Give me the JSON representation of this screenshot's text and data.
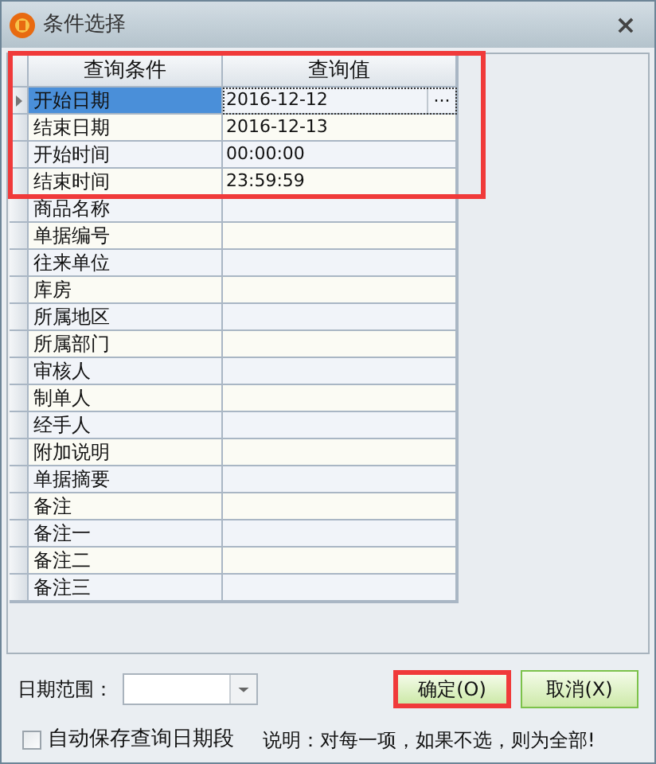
{
  "window": {
    "title": "条件选择",
    "close_label": "×"
  },
  "grid": {
    "columns": [
      "查询条件",
      "查询值"
    ],
    "highlighted_rows": [
      {
        "condition": "开始日期",
        "value": "2016-12-12",
        "selected": true,
        "ellipsis": "···"
      },
      {
        "condition": "结束日期",
        "value": "2016-12-13",
        "selected": false
      },
      {
        "condition": "开始时间",
        "value": "00:00:00",
        "selected": false
      },
      {
        "condition": "结束时间",
        "value": "23:59:59",
        "selected": false
      }
    ],
    "rows": [
      {
        "condition": "商品名称",
        "selected": false
      },
      {
        "condition": "单据编号",
        "selected": false
      },
      {
        "condition": "往来单位",
        "selected": false
      },
      {
        "condition": "库房",
        "selected": false
      },
      {
        "condition": "所属地区",
        "selected": false
      },
      {
        "condition": "所属部门",
        "selected": false
      },
      {
        "condition": "审核人",
        "selected": false
      },
      {
        "condition": "制单人",
        "selected": false
      },
      {
        "condition": "经手人",
        "selected": false
      },
      {
        "condition": "附加说明",
        "selected": false
      },
      {
        "condition": "单据摘要",
        "selected": false
      },
      {
        "condition": "备注",
        "selected": false
      },
      {
        "condition": "备注一",
        "selected": false
      },
      {
        "condition": "备注二",
        "selected": false
      },
      {
        "condition": "备注三",
        "selected": false
      }
    ]
  },
  "date_range": {
    "label": "日期范围："
  },
  "buttons": [
    {
      "label": "确定(O)",
      "highlighted": true
    },
    {
      "label": "取消(X)",
      "highlighted": false
    }
  ],
  "autosave": {
    "label": "自动保存查询日期段",
    "checked": false
  },
  "note": "说明：对每一项，如果不选，则为全部!"
}
